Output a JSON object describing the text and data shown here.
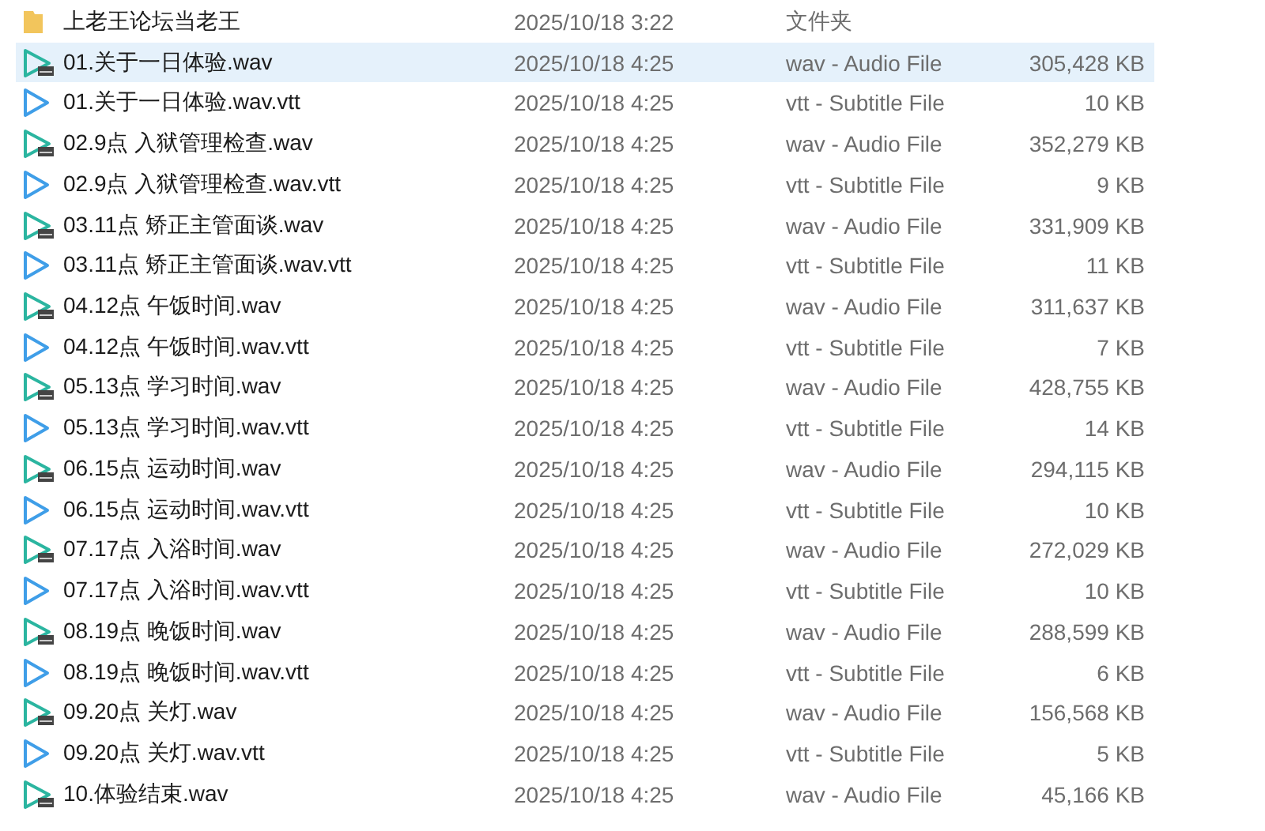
{
  "files": [
    {
      "kind": "folder",
      "name": "上老王论坛当老王",
      "date": "2025/10/18 3:22",
      "type": "文件夹",
      "selected": false
    },
    {
      "kind": "audio",
      "name": "01.关于一日体验.wav",
      "date": "2025/10/18 4:25",
      "type": "wav - Audio File",
      "size": "305,428 KB",
      "selected": true
    },
    {
      "kind": "subtitle",
      "name": "01.关于一日体验.wav.vtt",
      "date": "2025/10/18 4:25",
      "type": "vtt - Subtitle File",
      "size": "10 KB",
      "selected": false
    },
    {
      "kind": "audio",
      "name": "02.9点 入狱管理检查.wav",
      "date": "2025/10/18 4:25",
      "type": "wav - Audio File",
      "size": "352,279 KB",
      "selected": false
    },
    {
      "kind": "subtitle",
      "name": "02.9点 入狱管理检查.wav.vtt",
      "date": "2025/10/18 4:25",
      "type": "vtt - Subtitle File",
      "size": "9 KB",
      "selected": false
    },
    {
      "kind": "audio",
      "name": "03.11点 矫正主管面谈.wav",
      "date": "2025/10/18 4:25",
      "type": "wav - Audio File",
      "size": "331,909 KB",
      "selected": false
    },
    {
      "kind": "subtitle",
      "name": "03.11点 矫正主管面谈.wav.vtt",
      "date": "2025/10/18 4:25",
      "type": "vtt - Subtitle File",
      "size": "11 KB",
      "selected": false
    },
    {
      "kind": "audio",
      "name": "04.12点 午饭时间.wav",
      "date": "2025/10/18 4:25",
      "type": "wav - Audio File",
      "size": "311,637 KB",
      "selected": false
    },
    {
      "kind": "subtitle",
      "name": "04.12点 午饭时间.wav.vtt",
      "date": "2025/10/18 4:25",
      "type": "vtt - Subtitle File",
      "size": "7 KB",
      "selected": false
    },
    {
      "kind": "audio",
      "name": "05.13点 学习时间.wav",
      "date": "2025/10/18 4:25",
      "type": "wav - Audio File",
      "size": "428,755 KB",
      "selected": false
    },
    {
      "kind": "subtitle",
      "name": "05.13点 学习时间.wav.vtt",
      "date": "2025/10/18 4:25",
      "type": "vtt - Subtitle File",
      "size": "14 KB",
      "selected": false
    },
    {
      "kind": "audio",
      "name": "06.15点 运动时间.wav",
      "date": "2025/10/18 4:25",
      "type": "wav - Audio File",
      "size": "294,115 KB",
      "selected": false
    },
    {
      "kind": "subtitle",
      "name": "06.15点 运动时间.wav.vtt",
      "date": "2025/10/18 4:25",
      "type": "vtt - Subtitle File",
      "size": "10 KB",
      "selected": false
    },
    {
      "kind": "audio",
      "name": "07.17点 入浴时间.wav",
      "date": "2025/10/18 4:25",
      "type": "wav - Audio File",
      "size": "272,029 KB",
      "selected": false
    },
    {
      "kind": "subtitle",
      "name": "07.17点 入浴时间.wav.vtt",
      "date": "2025/10/18 4:25",
      "type": "vtt - Subtitle File",
      "size": "10 KB",
      "selected": false
    },
    {
      "kind": "audio",
      "name": "08.19点 晚饭时间.wav",
      "date": "2025/10/18 4:25",
      "type": "wav - Audio File",
      "size": "288,599 KB",
      "selected": false
    },
    {
      "kind": "subtitle",
      "name": "08.19点 晚饭时间.wav.vtt",
      "date": "2025/10/18 4:25",
      "type": "vtt - Subtitle File",
      "size": "6 KB",
      "selected": false
    },
    {
      "kind": "audio",
      "name": "09.20点 关灯.wav",
      "date": "2025/10/18 4:25",
      "type": "wav - Audio File",
      "size": "156,568 KB",
      "selected": false
    },
    {
      "kind": "subtitle",
      "name": "09.20点 关灯.wav.vtt",
      "date": "2025/10/18 4:25",
      "type": "vtt - Subtitle File",
      "size": "5 KB",
      "selected": false
    },
    {
      "kind": "audio",
      "name": "10.体验结束.wav",
      "date": "2025/10/18 4:25",
      "type": "wav - Audio File",
      "size": "45,166 KB",
      "selected": false
    }
  ]
}
